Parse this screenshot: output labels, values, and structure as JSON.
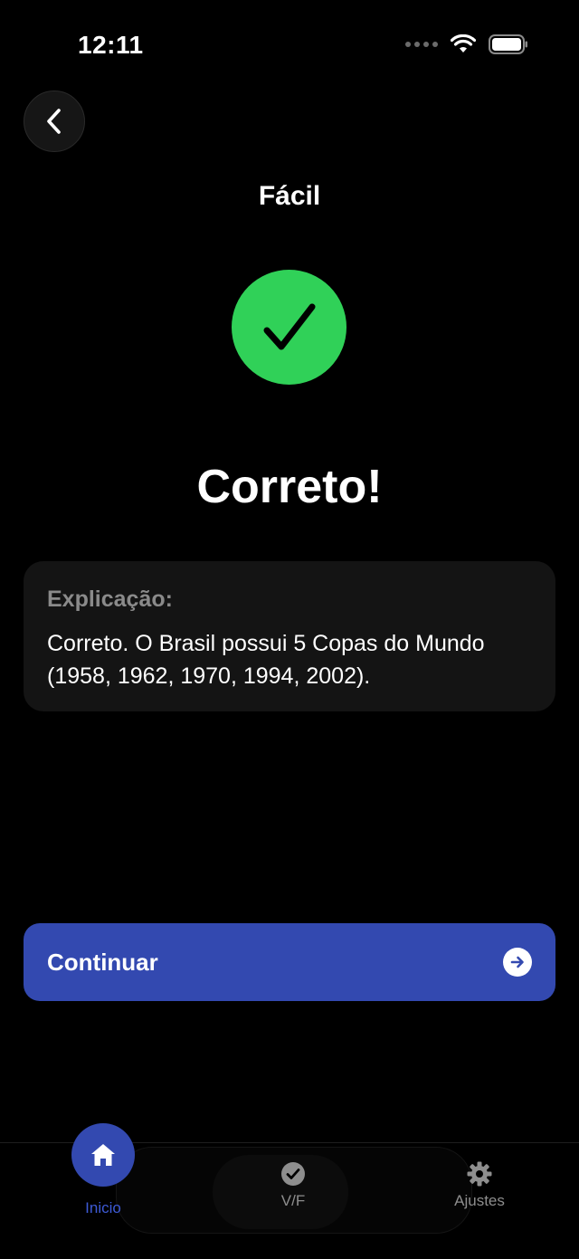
{
  "status_bar": {
    "time": "12:11"
  },
  "header": {
    "title": "Fácil"
  },
  "result": {
    "title": "Correto!",
    "icon": "checkmark-icon",
    "color": "#30d158"
  },
  "explanation": {
    "label": "Explicação:",
    "text": "Correto. O Brasil possui 5 Copas do Mundo (1958, 1962, 1970, 1994, 2002)."
  },
  "continue_button": {
    "label": "Continuar",
    "icon": "arrow-right-circle-icon"
  },
  "tab_bar": {
    "tabs": [
      {
        "label": "Inicio",
        "icon": "home-icon",
        "active": true
      },
      {
        "label": "V/F",
        "icon": "check-circle-icon",
        "active": false
      },
      {
        "label": "Ajustes",
        "icon": "gear-icon",
        "active": false
      }
    ]
  },
  "colors": {
    "accent": "#3349b0",
    "success": "#30d158",
    "background": "#000000",
    "card": "#141414"
  }
}
